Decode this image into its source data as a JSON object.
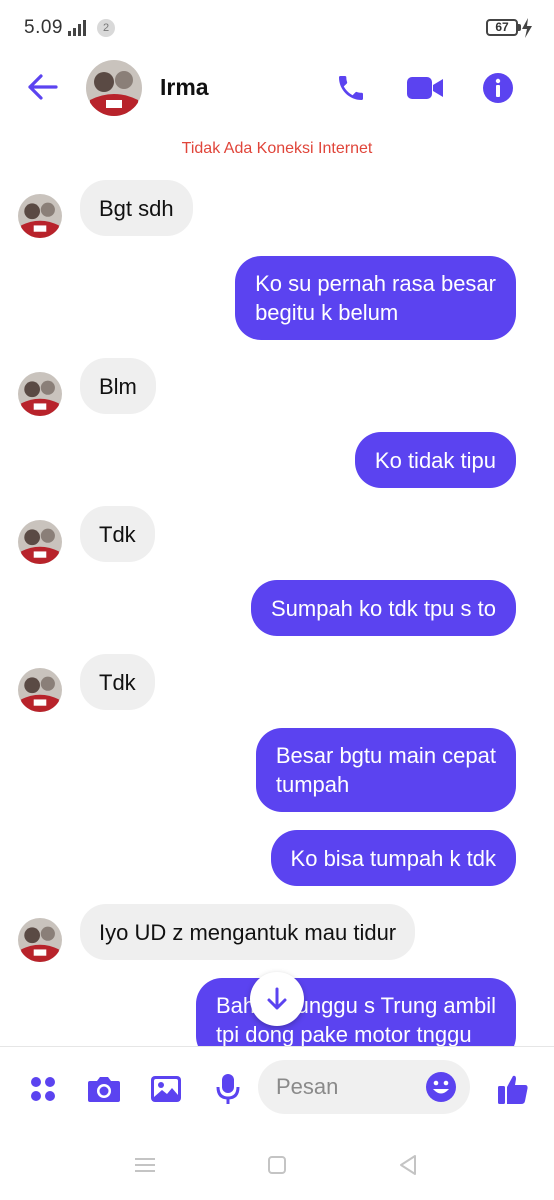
{
  "status_bar": {
    "time": "5.09",
    "sim": "2",
    "battery": "67"
  },
  "header": {
    "contact_name": "Irma"
  },
  "connection_warning": "Tidak Ada Koneksi Internet",
  "messages": [
    {
      "from": "them",
      "lines": [
        "Bgt sdh"
      ]
    },
    {
      "from": "me",
      "lines": [
        "Ko su pernah rasa besar",
        "begitu k belum"
      ]
    },
    {
      "from": "them",
      "lines": [
        "Blm"
      ]
    },
    {
      "from": "me",
      "lines": [
        "Ko tidak tipu"
      ]
    },
    {
      "from": "them",
      "lines": [
        "Tdk"
      ]
    },
    {
      "from": "me",
      "lines": [
        "Sumpah ko tdk tpu s to"
      ]
    },
    {
      "from": "them",
      "lines": [
        "Tdk"
      ]
    },
    {
      "from": "me",
      "lines": [
        "Besar bgtu main cepat",
        "tumpah"
      ]
    },
    {
      "from": "me",
      "lines": [
        "Ko bisa tumpah k tdk"
      ]
    },
    {
      "from": "them",
      "lines": [
        "Iyo UD z mengantuk mau tidur"
      ]
    },
    {
      "from": "me",
      "lines": [
        "Bah ko tunggu s Trung ambil",
        "tpi dong pake motor tnggu"
      ]
    }
  ],
  "composer": {
    "placeholder": "Pesan"
  },
  "colors": {
    "accent": "#5b43f0",
    "incoming_bubble": "#efefef",
    "warning": "#e0453a"
  },
  "icons": [
    "back-arrow-icon",
    "phone-icon",
    "video-camera-icon",
    "info-icon",
    "menu-dots-icon",
    "camera-icon",
    "image-icon",
    "microphone-icon",
    "emoji-icon",
    "thumbs-up-icon",
    "scroll-down-arrow-icon"
  ]
}
